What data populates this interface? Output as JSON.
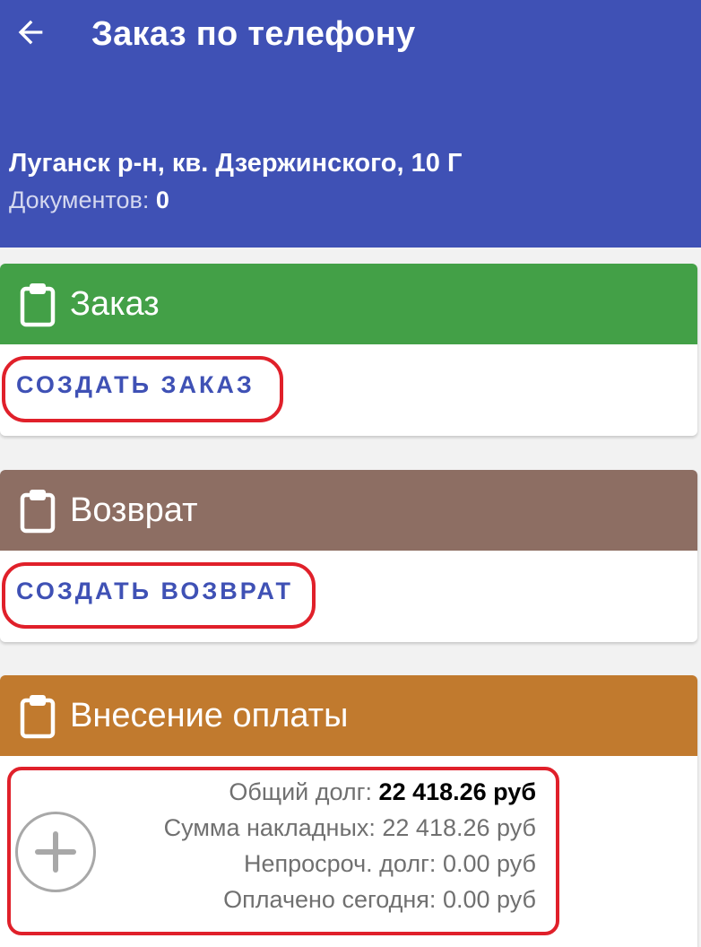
{
  "header": {
    "title": "Заказ по телефону",
    "address": "Луганск р-н, кв. Дзержинского, 10 Г",
    "documents_label": "Документов:",
    "documents_count": "0",
    "color": "#3f51b5",
    "back_icon": "arrow-left-icon"
  },
  "order": {
    "title": "Заказ",
    "action": "СОЗДАТЬ ЗАКАЗ",
    "color": "#43a047",
    "icon": "clipboard-icon"
  },
  "return": {
    "title": "Возврат",
    "action": "СОЗДАТЬ ВОЗВРАТ",
    "color": "#8d6e63",
    "icon": "clipboard-icon"
  },
  "payment": {
    "title": "Внесение оплаты",
    "color": "#c17a2e",
    "icon": "clipboard-icon",
    "add_icon": "plus-circle-icon",
    "lines": [
      {
        "label": "Общий долг:",
        "value": "22 418.26 руб"
      },
      {
        "label": "Сумма накладных:",
        "value": "22 418.26 руб"
      },
      {
        "label": "Непросроч. долг:",
        "value": "0.00 руб"
      },
      {
        "label": "Оплачено сегодня:",
        "value": "0.00 руб"
      }
    ]
  },
  "highlight_color": "#e0202a"
}
